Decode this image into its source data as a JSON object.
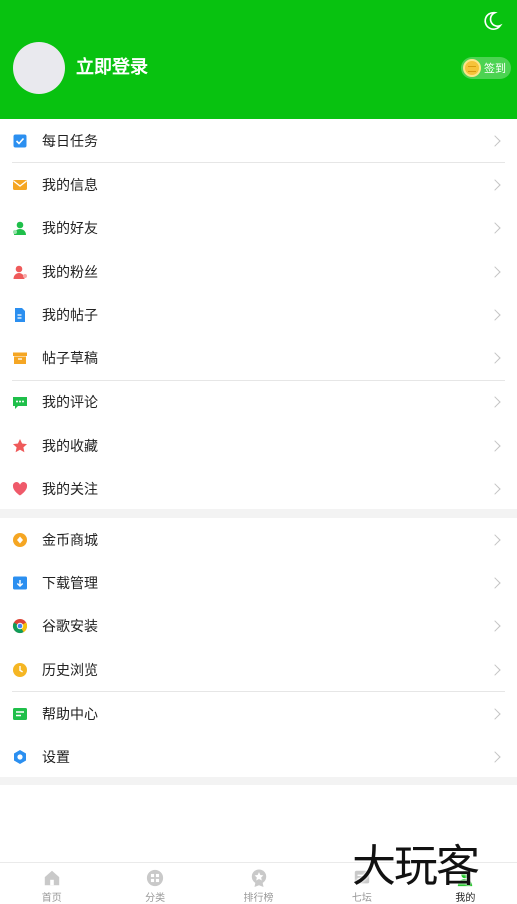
{
  "header": {
    "login_label": "立即登录",
    "checkin_label": "签到",
    "bg_color": "#08c210"
  },
  "menu_group1": [
    {
      "label": "每日任务",
      "icon": "task-check-icon",
      "color": "#2b8ff0"
    },
    {
      "label": "我的信息",
      "icon": "mail-icon",
      "color": "#f5a623"
    },
    {
      "label": "我的好友",
      "icon": "friend-icon",
      "color": "#1fbf4a"
    },
    {
      "label": "我的粉丝",
      "icon": "fans-icon",
      "color": "#ef5a5a"
    },
    {
      "label": "我的帖子",
      "icon": "post-doc-icon",
      "color": "#2b8ff0"
    },
    {
      "label": "帖子草稿",
      "icon": "draft-box-icon",
      "color": "#f5a623"
    },
    {
      "label": "我的评论",
      "icon": "comment-icon",
      "color": "#1fbf4a"
    },
    {
      "label": "我的收藏",
      "icon": "star-icon",
      "color": "#ef5a5a"
    },
    {
      "label": "我的关注",
      "icon": "heart-icon",
      "color": "#ef5a6a"
    }
  ],
  "menu_group2": [
    {
      "label": "金币商城",
      "icon": "coin-shop-icon",
      "color": "#f5a623"
    },
    {
      "label": "下载管理",
      "icon": "download-icon",
      "color": "#2b8ff0"
    },
    {
      "label": "谷歌安装",
      "icon": "chrome-icon",
      "color": "#db4437"
    },
    {
      "label": "历史浏览",
      "icon": "clock-icon",
      "color": "#f5b623"
    },
    {
      "label": "帮助中心",
      "icon": "help-icon",
      "color": "#1fbf4a"
    },
    {
      "label": "设置",
      "icon": "settings-icon",
      "color": "#2b8ff0"
    }
  ],
  "tabs": [
    {
      "label": "首页",
      "icon": "home-icon"
    },
    {
      "label": "分类",
      "icon": "category-icon"
    },
    {
      "label": "排行榜",
      "icon": "ranking-icon"
    },
    {
      "label": "七坛",
      "icon": "forum-icon"
    },
    {
      "label": "我的",
      "icon": "profile-icon",
      "active": true
    }
  ],
  "watermark": "大玩客"
}
